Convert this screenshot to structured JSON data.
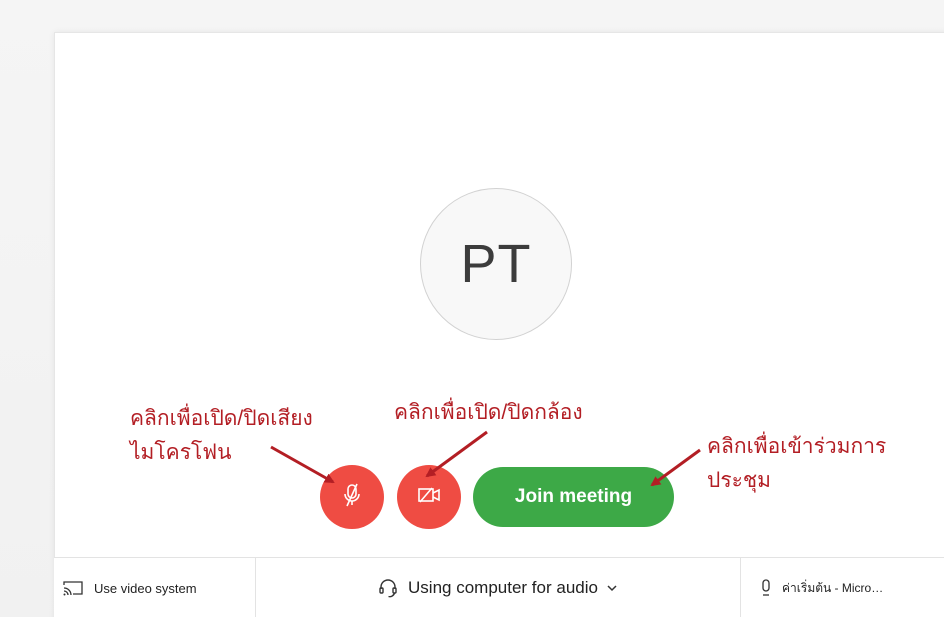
{
  "avatar": {
    "initials": "PT"
  },
  "controls": {
    "mic_icon": "microphone-muted-icon",
    "camera_icon": "camera-off-icon",
    "join_label": "Join meeting"
  },
  "bottom_bar": {
    "video_system_label": "Use video system",
    "audio_label": "Using computer for audio",
    "microphone_label": "ค่าเริ่มต้น - Micro…"
  },
  "annotations": {
    "mic_line1": "คลิกเพื่อเปิด/ปิดเสียง",
    "mic_line2": "ไมโครโฟน",
    "camera": "คลิกเพื่อเปิด/ปิดกล้อง",
    "join_line1": "คลิกเพื่อเข้าร่วมการ",
    "join_line2": "ประชุม"
  },
  "colors": {
    "mute_button": "#ef4c43",
    "join_button": "#3da947",
    "annotation_text": "#b31e24"
  }
}
